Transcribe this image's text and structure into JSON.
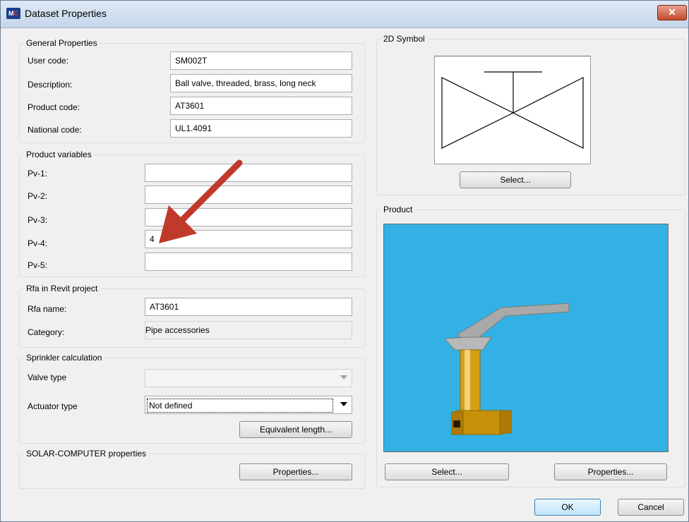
{
  "window": {
    "title": "Dataset Properties",
    "icon_label_m": "M",
    "icon_label_c": "C",
    "close_glyph": "✕"
  },
  "general": {
    "title": "General Properties",
    "user_code_label": "User code:",
    "user_code": "SM002T",
    "description_label": "Description:",
    "description": "Ball valve, threaded, brass, long neck",
    "product_code_label": "Product code:",
    "product_code": "AT3601",
    "national_code_label": "National code:",
    "national_code": "UL1.4091"
  },
  "product_variables": {
    "title": "Product variables",
    "items": [
      {
        "label": "Pv-1:",
        "value": ""
      },
      {
        "label": "Pv-2:",
        "value": ""
      },
      {
        "label": "Pv-3:",
        "value": ""
      },
      {
        "label": "Pv-4:",
        "value": "4"
      },
      {
        "label": "Pv-5:",
        "value": ""
      }
    ]
  },
  "rfa": {
    "title": "Rfa in Revit project",
    "name_label": "Rfa name:",
    "name": "AT3601",
    "category_label": "Category:",
    "category": "Pipe accessories"
  },
  "sprinkler": {
    "title": "Sprinkler calculation",
    "valve_type_label": "Valve type",
    "valve_type": "",
    "actuator_type_label": "Actuator type",
    "actuator_type": "Not defined",
    "equivalent_length_button": "Equivalent length..."
  },
  "solar": {
    "title": "SOLAR-COMPUTER properties",
    "properties_button": "Properties..."
  },
  "symbol2d": {
    "title": "2D Symbol",
    "select_button": "Select..."
  },
  "product": {
    "title": "Product",
    "select_button": "Select...",
    "properties_button": "Properties..."
  },
  "footer": {
    "ok_button": "OK",
    "cancel_button": "Cancel"
  },
  "colors": {
    "preview_background": "#33b1e4",
    "annotation_arrow": "#c0392b",
    "valve_brass": "#d4a017",
    "valve_handle": "#a9a9a9"
  }
}
